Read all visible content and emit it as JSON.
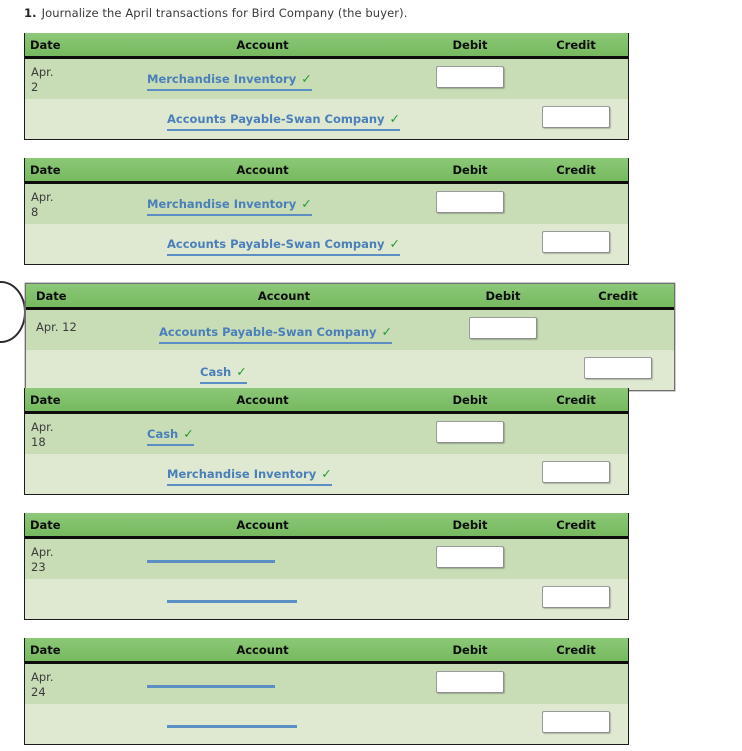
{
  "prompt": {
    "number": "1.",
    "text": "Journalize the April transactions for Bird Company (the buyer)."
  },
  "columns": {
    "date": "Date",
    "account": "Account",
    "debit": "Debit",
    "credit": "Credit"
  },
  "icons": {
    "check": "✓",
    "check_name": "checkmark-icon"
  },
  "colors": {
    "header_green": "#80c06a",
    "row_debit_bg": "#c8dcb6",
    "row_credit_bg": "#dfe9d1",
    "link_blue": "#4a7fba",
    "check_green": "#1f9c2e",
    "border_black": "#1b1b1b",
    "selected_border": "#6f6f6f"
  },
  "entries": [
    {
      "id": "entry-apr-2",
      "selected": false,
      "date_lines": [
        "Apr.",
        "2"
      ],
      "debit_row": {
        "account": "Merchandise Inventory",
        "verified": true,
        "blank": false,
        "amount": "",
        "placeholder": ""
      },
      "credit_row": {
        "account": "Accounts Payable-Swan Company",
        "verified": true,
        "blank": false,
        "amount": "",
        "placeholder": ""
      }
    },
    {
      "id": "entry-apr-8",
      "selected": false,
      "date_lines": [
        "Apr.",
        "8"
      ],
      "debit_row": {
        "account": "Merchandise Inventory",
        "verified": true,
        "blank": false,
        "amount": "",
        "placeholder": ""
      },
      "credit_row": {
        "account": "Accounts Payable-Swan Company",
        "verified": true,
        "blank": false,
        "amount": "",
        "placeholder": ""
      }
    },
    {
      "id": "entry-apr-12",
      "selected": true,
      "date_lines": [
        "Apr. 12"
      ],
      "debit_row": {
        "account": "Accounts Payable-Swan Company",
        "verified": true,
        "blank": false,
        "amount": "",
        "placeholder": ""
      },
      "credit_row": {
        "account": "Cash",
        "verified": true,
        "blank": false,
        "amount": "",
        "placeholder": ""
      }
    },
    {
      "id": "entry-apr-18",
      "selected": false,
      "date_lines": [
        "Apr.",
        "18"
      ],
      "debit_row": {
        "account": "Cash",
        "verified": true,
        "blank": false,
        "amount": "",
        "placeholder": ""
      },
      "credit_row": {
        "account": "Merchandise Inventory",
        "verified": true,
        "blank": false,
        "amount": "",
        "placeholder": ""
      }
    },
    {
      "id": "entry-apr-23",
      "selected": false,
      "date_lines": [
        "Apr.",
        "23"
      ],
      "debit_row": {
        "account": "",
        "verified": false,
        "blank": true,
        "amount": "",
        "placeholder": ""
      },
      "credit_row": {
        "account": "",
        "verified": false,
        "blank": true,
        "amount": "",
        "placeholder": ""
      }
    },
    {
      "id": "entry-apr-24",
      "selected": false,
      "date_lines": [
        "Apr.",
        "24"
      ],
      "debit_row": {
        "account": "",
        "verified": false,
        "blank": true,
        "amount": "",
        "placeholder": ""
      },
      "credit_row": {
        "account": "",
        "verified": false,
        "blank": true,
        "amount": "",
        "placeholder": ""
      }
    }
  ],
  "layout": {
    "table_tops": [
      33,
      158,
      283,
      388,
      513,
      638
    ]
  }
}
